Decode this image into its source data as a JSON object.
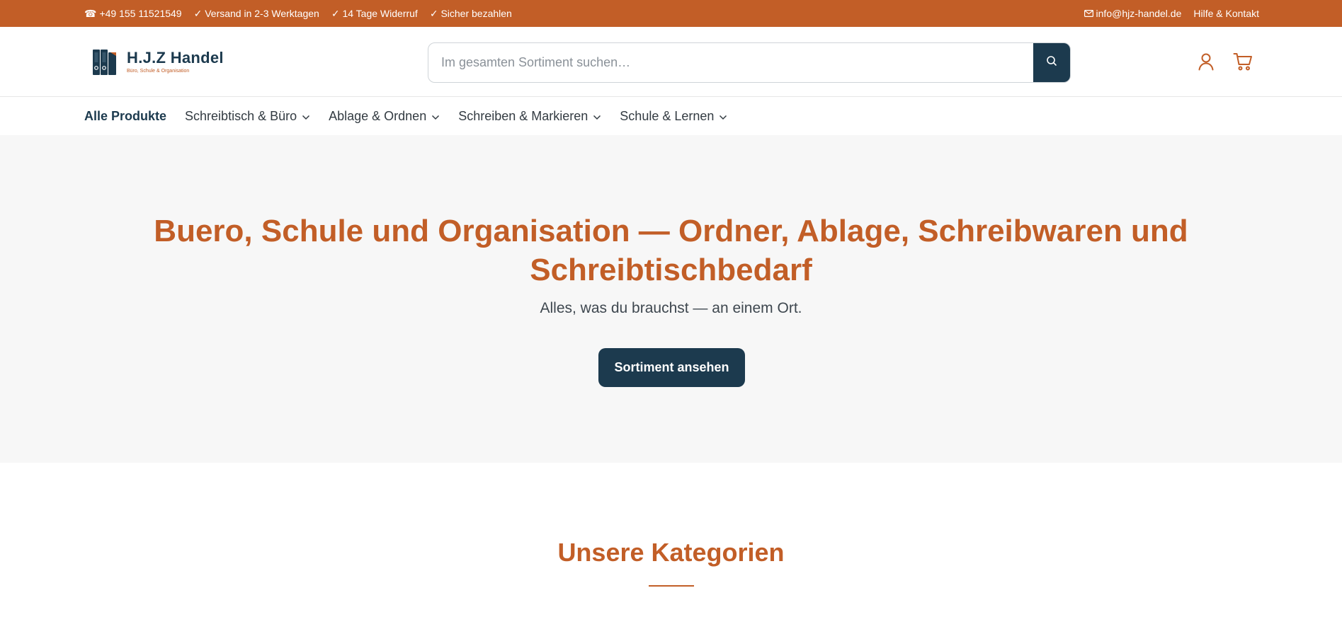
{
  "topbar": {
    "phone": "+49 155 11521549",
    "usps": [
      "✓ Versand in 2-3 Werktagen",
      "✓ 14 Tage Widerruf",
      "✓ Sicher bezahlen"
    ],
    "email": "info@hjz-handel.de",
    "help": "Hilfe & Kontakt"
  },
  "header": {
    "brand_name": "H.J.Z Handel",
    "brand_tagline": "Büro, Schule & Organisation",
    "search_placeholder": "Im gesamten Sortiment suchen…",
    "search_value": ""
  },
  "nav": {
    "items": [
      {
        "label": "Alle Produkte",
        "dropdown": false
      },
      {
        "label": "Schreibtisch & Büro",
        "dropdown": true
      },
      {
        "label": "Ablage & Ordnen",
        "dropdown": true
      },
      {
        "label": "Schreiben & Markieren",
        "dropdown": true
      },
      {
        "label": "Schule & Lernen",
        "dropdown": true
      }
    ]
  },
  "hero": {
    "title": "Buero, Schule und Organisation — Ordner, Ablage, Schreibwaren und Schreibtischbedarf",
    "subtitle": "Alles, was du brauchst — an einem Ort.",
    "cta": "Sortiment ansehen"
  },
  "categories": {
    "title": "Unsere Kategorien"
  },
  "colors": {
    "accent": "#c25e27",
    "primary": "#1c3a4e",
    "hero_bg": "#f7f7f7"
  },
  "icons": [
    "phone-icon",
    "mail-icon",
    "search-icon",
    "user-icon",
    "cart-icon",
    "chevron-down-icon",
    "binder-logo-icon"
  ]
}
